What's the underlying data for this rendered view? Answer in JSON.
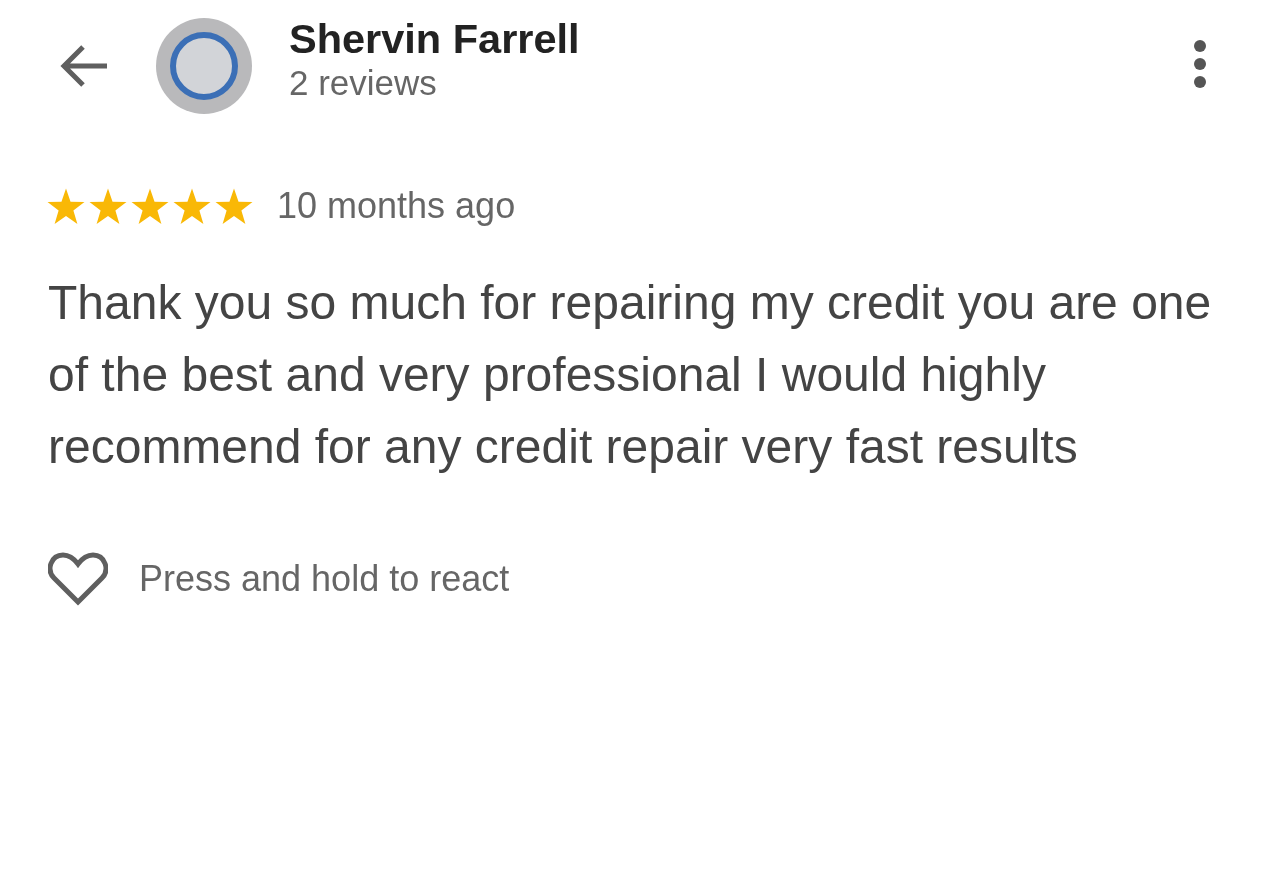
{
  "header": {
    "name": "Shervin Farrell",
    "review_count": "2 reviews"
  },
  "review": {
    "stars": 5,
    "time": "10 months ago",
    "text": "Thank you so much for repairing my credit you are one of the best and very professional I would highly recommend for any credit repair very fast results"
  },
  "reaction": {
    "hint": "Press and hold to react"
  }
}
